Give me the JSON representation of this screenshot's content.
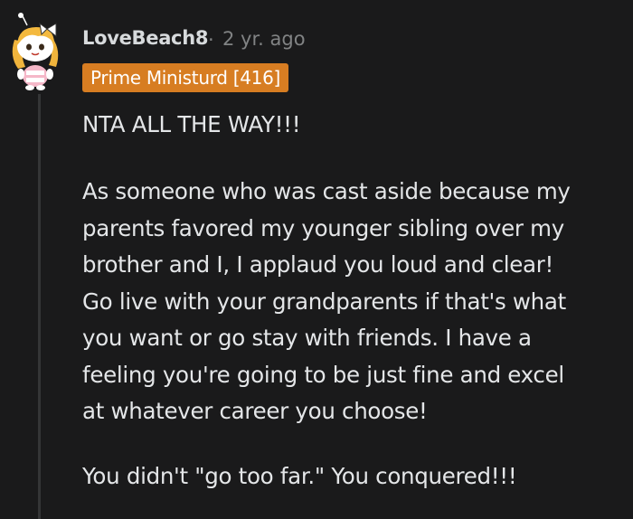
{
  "comment": {
    "author": "LoveBeach8",
    "separator": "·",
    "time": "2 yr. ago",
    "flair": "Prime Ministurd [416]",
    "avatar": "snoo-avatar-icon",
    "paragraph1": "NTA ALL THE WAY!!!",
    "paragraph2_lines": [
      "As someone who was cast aside because my",
      "parents favored my younger sibling over my",
      "brother and I, I applaud you loud and clear!",
      "Go live with your grandparents if that's what",
      "you want or go stay with friends. I have a",
      "feeling you're going to be just fine and excel",
      "at whatever career you choose!"
    ],
    "paragraph3": "You didn't \"go too far.\" You conquered!!!"
  },
  "colors": {
    "background": "#1a1a1b",
    "flair_bg": "#d77d22",
    "meta_text": "#818384",
    "body_text": "#e4e6e8",
    "thread_line": "#343536"
  }
}
